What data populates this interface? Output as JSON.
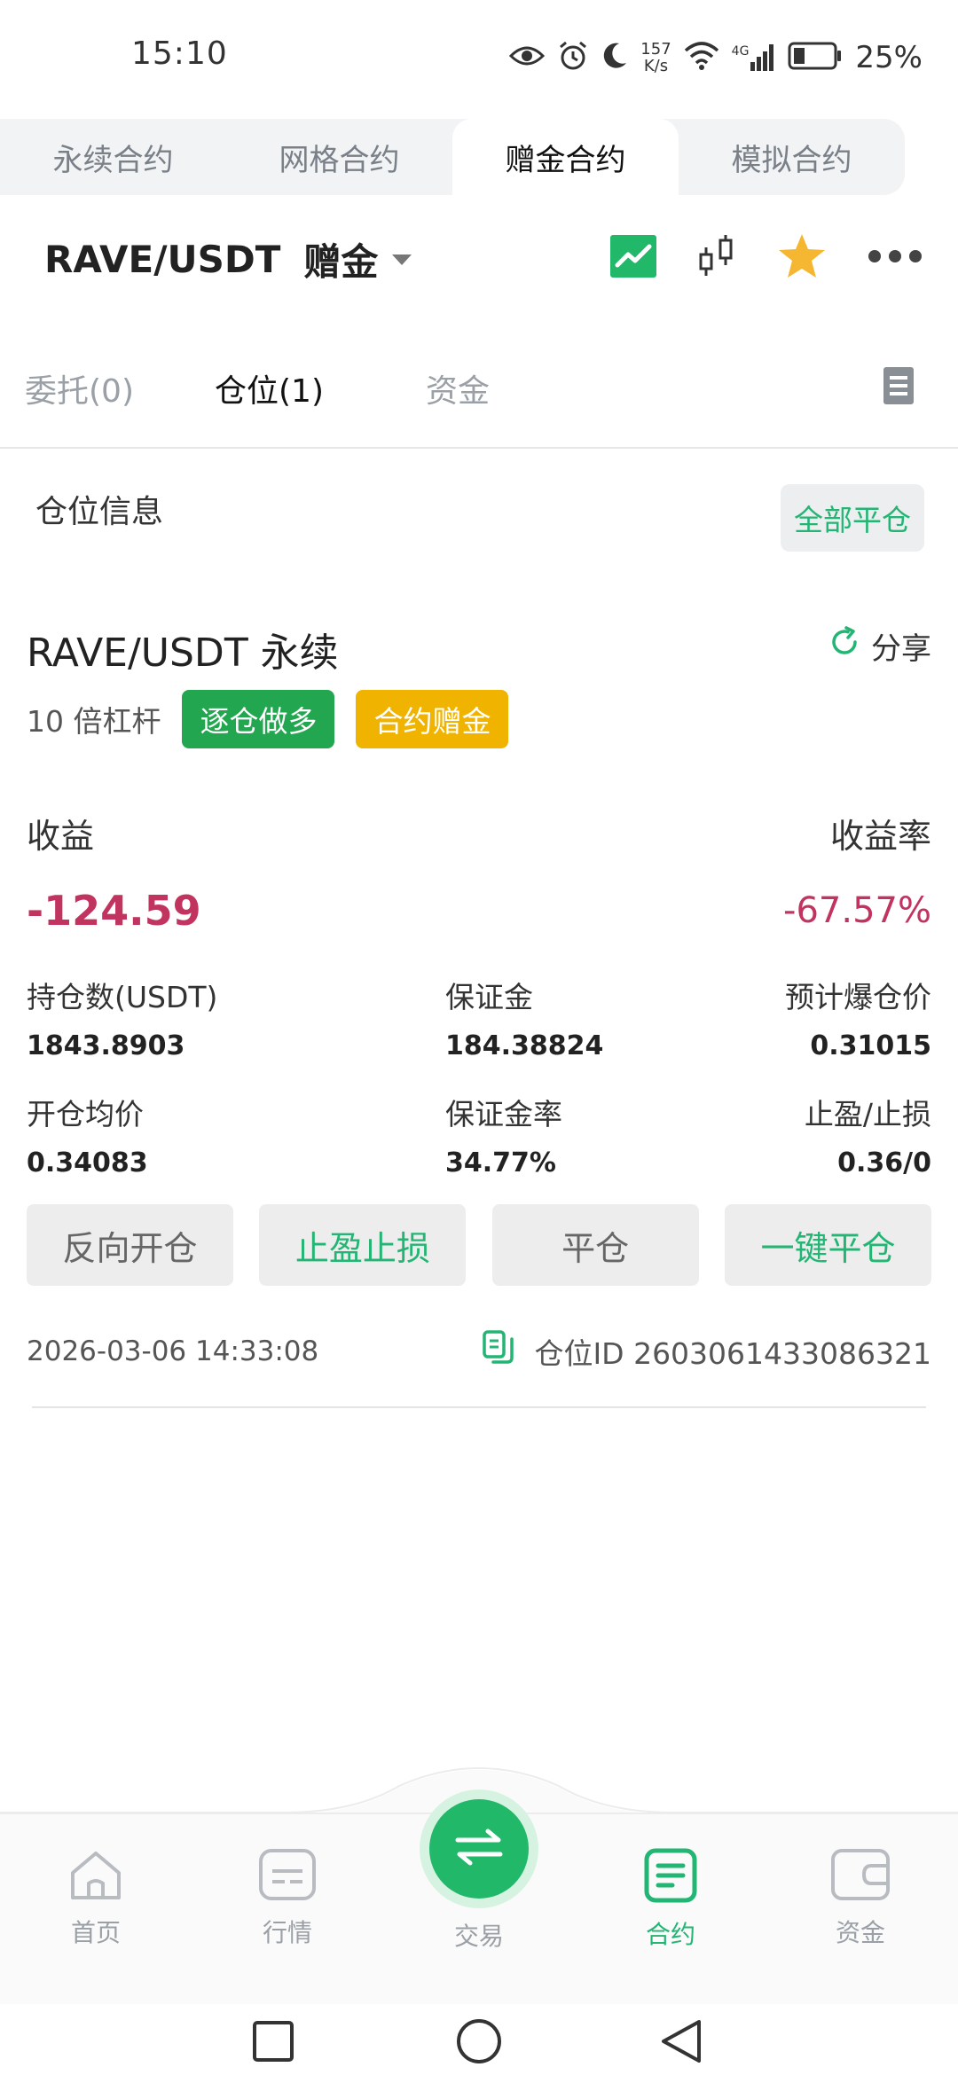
{
  "status_bar": {
    "time": "15:10",
    "net_speed_value": "157",
    "net_speed_unit": "K/s",
    "network_type": "4G",
    "battery_percent": "25%"
  },
  "contract_tabs": [
    {
      "label": "永续合约",
      "active": false
    },
    {
      "label": "网格合约",
      "active": false
    },
    {
      "label": "赠金合约",
      "active": true
    },
    {
      "label": "模拟合约",
      "active": false
    }
  ],
  "header": {
    "pair": "RAVE/USDT",
    "tag": "赠金",
    "icons": [
      "chart-icon",
      "candlestick-icon",
      "star-icon",
      "more-icon"
    ]
  },
  "sub_tabs": [
    {
      "label": "委托(0)",
      "active": false
    },
    {
      "label": "仓位(1)",
      "active": true
    },
    {
      "label": "资金",
      "active": false
    }
  ],
  "position_section": {
    "title": "仓位信息",
    "close_all": "全部平仓"
  },
  "position": {
    "symbol": "RAVE/USDT 永续",
    "share": "分享",
    "leverage": "10 倍杠杆",
    "badge_mode": "逐仓做多",
    "badge_bonus": "合约赠金",
    "pnl_label": "收益",
    "pnl_rate_label": "收益率",
    "pnl": "-124.59",
    "pnl_rate": "-67.57%",
    "fields": {
      "size_label": "持仓数(USDT)",
      "size": "1843.8903",
      "margin_label": "保证金",
      "margin": "184.38824",
      "liq_label": "预计爆仓价",
      "liq": "0.31015",
      "entry_label": "开仓均价",
      "entry": "0.34083",
      "margin_ratio_label": "保证金率",
      "margin_ratio": "34.77%",
      "tpsl_label": "止盈/止损",
      "tpsl": "0.36/0"
    },
    "actions": {
      "reverse": "反向开仓",
      "tpsl": "止盈止损",
      "close": "平仓",
      "quick_close": "一键平仓"
    },
    "timestamp": "2026-03-06 14:33:08",
    "position_id": "仓位ID 2603061433086321"
  },
  "bottom_nav": {
    "home": "首页",
    "market": "行情",
    "trade": "交易",
    "contract": "合约",
    "assets": "资金"
  },
  "colors": {
    "accent_green": "#22b573",
    "loss_red": "#c0345f",
    "badge_yellow": "#f0b400",
    "badge_green": "#22a64f"
  }
}
